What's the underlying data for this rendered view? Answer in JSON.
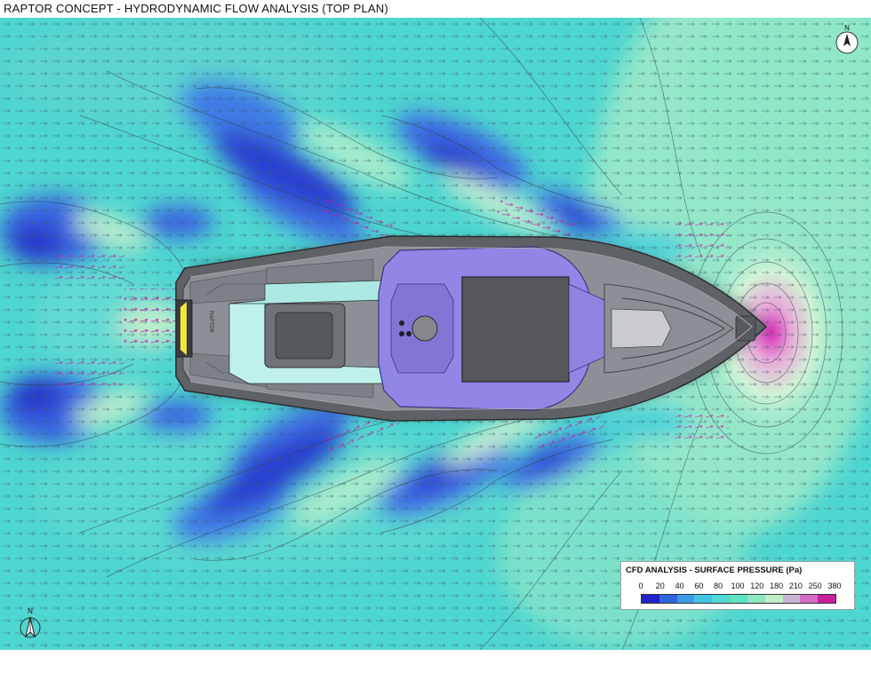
{
  "title": "RAPTOR CONCEPT - HYDRODYNAMIC FLOW ANALYSIS (TOP PLAN)",
  "legend": {
    "title": "CFD ANALYSIS - SURFACE PRESSURE (Pa)",
    "ticks": [
      "0",
      "20",
      "40",
      "60",
      "80",
      "100",
      "120",
      "180",
      "210",
      "250",
      "380"
    ],
    "colors": [
      "#1f23c9",
      "#2f63e0",
      "#3d9be6",
      "#45c3e3",
      "#4fd9d4",
      "#5fe3c3",
      "#8fe8c2",
      "#c3ecc9",
      "#c9b5d6",
      "#d56dc3",
      "#c41f9e"
    ]
  },
  "compass": {
    "north_label": "N"
  },
  "field_colors": {
    "background": "#4ed6d0",
    "low": "#3e6ee6",
    "very_low": "#2a3ed0",
    "mid": "#77e3c8",
    "high": "#c5f0cf",
    "peak": "#d03cb6"
  },
  "hull": {
    "brand": "RAPTOR",
    "colors": {
      "hull": "#5e6166",
      "deck": "#8c8f95",
      "cockpit": "#8f86e6",
      "glass": "#bff0ea",
      "accent": "#f2e63a"
    }
  }
}
